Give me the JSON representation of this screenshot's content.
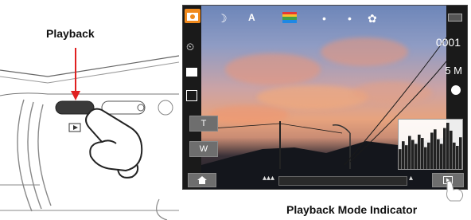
{
  "labels": {
    "playback": "Playback",
    "indicator": "Playback Mode Indicator"
  },
  "screen": {
    "frame_count": "0001",
    "resolution": "5 M",
    "zoom_tele": "T",
    "zoom_wide": "W"
  },
  "icons": {
    "top_row": [
      "camera-mode-icon",
      "night-scene-icon",
      "auto-scene-icon",
      "color-mode-icon",
      "metering-icon",
      "white-balance-icon",
      "macro-icon",
      "battery-icon"
    ],
    "left_column": [
      "self-timer-icon",
      "image-size-icon",
      "quality-icon"
    ],
    "bottom": [
      "home-icon",
      "zoom-wide-icon",
      "zoom-tele-icon",
      "playback-icon"
    ]
  },
  "colors": {
    "arrow": "#e02020",
    "mode_active": "#f08a1e",
    "color_mode_stripes": [
      "#e53935",
      "#fbc02d",
      "#43a047",
      "#1e88e5"
    ]
  },
  "histogram": [
    30,
    42,
    36,
    50,
    44,
    38,
    52,
    47,
    33,
    40,
    55,
    60,
    45,
    38,
    62,
    70,
    58,
    40,
    35,
    48
  ]
}
